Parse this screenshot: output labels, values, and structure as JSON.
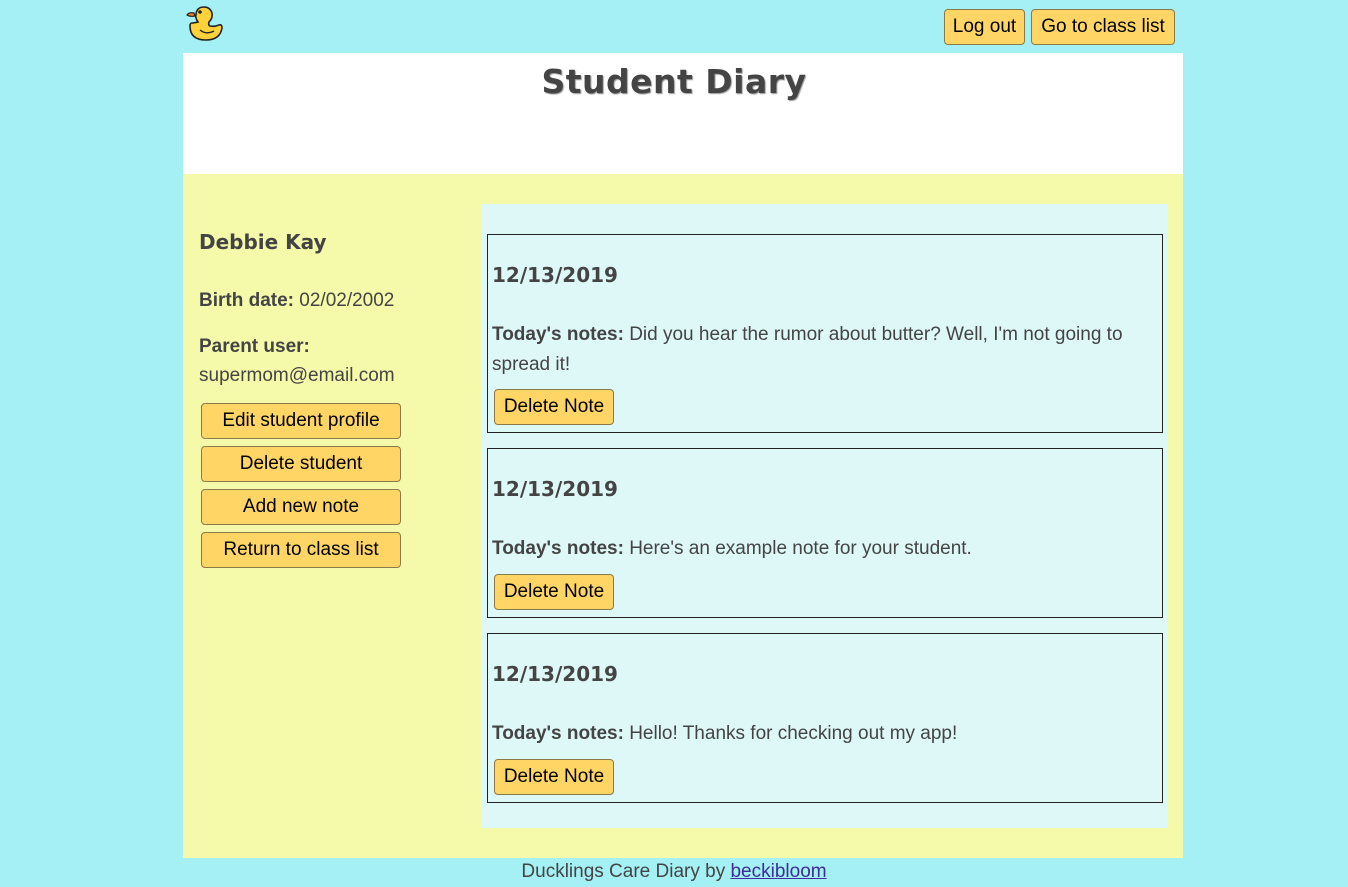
{
  "app": {
    "logo_icon": "rubber-duck-icon",
    "brand_color": "#a5f0f4"
  },
  "topbar": {
    "logout_label": "Log out",
    "classlist_label": "Go to class list"
  },
  "header": {
    "title": "Student Diary"
  },
  "student": {
    "name": "Debbie Kay",
    "birth_label": "Birth date:",
    "birth_value": "02/02/2002",
    "parent_label": "Parent user:",
    "parent_value": "supermom@email.com"
  },
  "actions": {
    "edit_label": "Edit student profile",
    "delete_label": "Delete student",
    "add_label": "Add new note",
    "return_label": "Return to class list"
  },
  "notes": [
    {
      "date": "12/13/2019",
      "notes_label": "Today's notes:",
      "text": "Did you hear the rumor about butter? Well, I'm not going to spread it!",
      "delete_label": "Delete Note"
    },
    {
      "date": "12/13/2019",
      "notes_label": "Today's notes:",
      "text": "Here's an example note for your student.",
      "delete_label": "Delete Note"
    },
    {
      "date": "12/13/2019",
      "notes_label": "Today's notes:",
      "text": "Hello! Thanks for checking out my app!",
      "delete_label": "Delete Note"
    }
  ],
  "footer": {
    "text": "Ducklings Care Diary by",
    "link_label": "beckibloom"
  },
  "colors": {
    "button": "#ffd666",
    "main_panel": "#f5f9aa",
    "notes_panel": "#def7f7",
    "header": "#ffffff"
  }
}
